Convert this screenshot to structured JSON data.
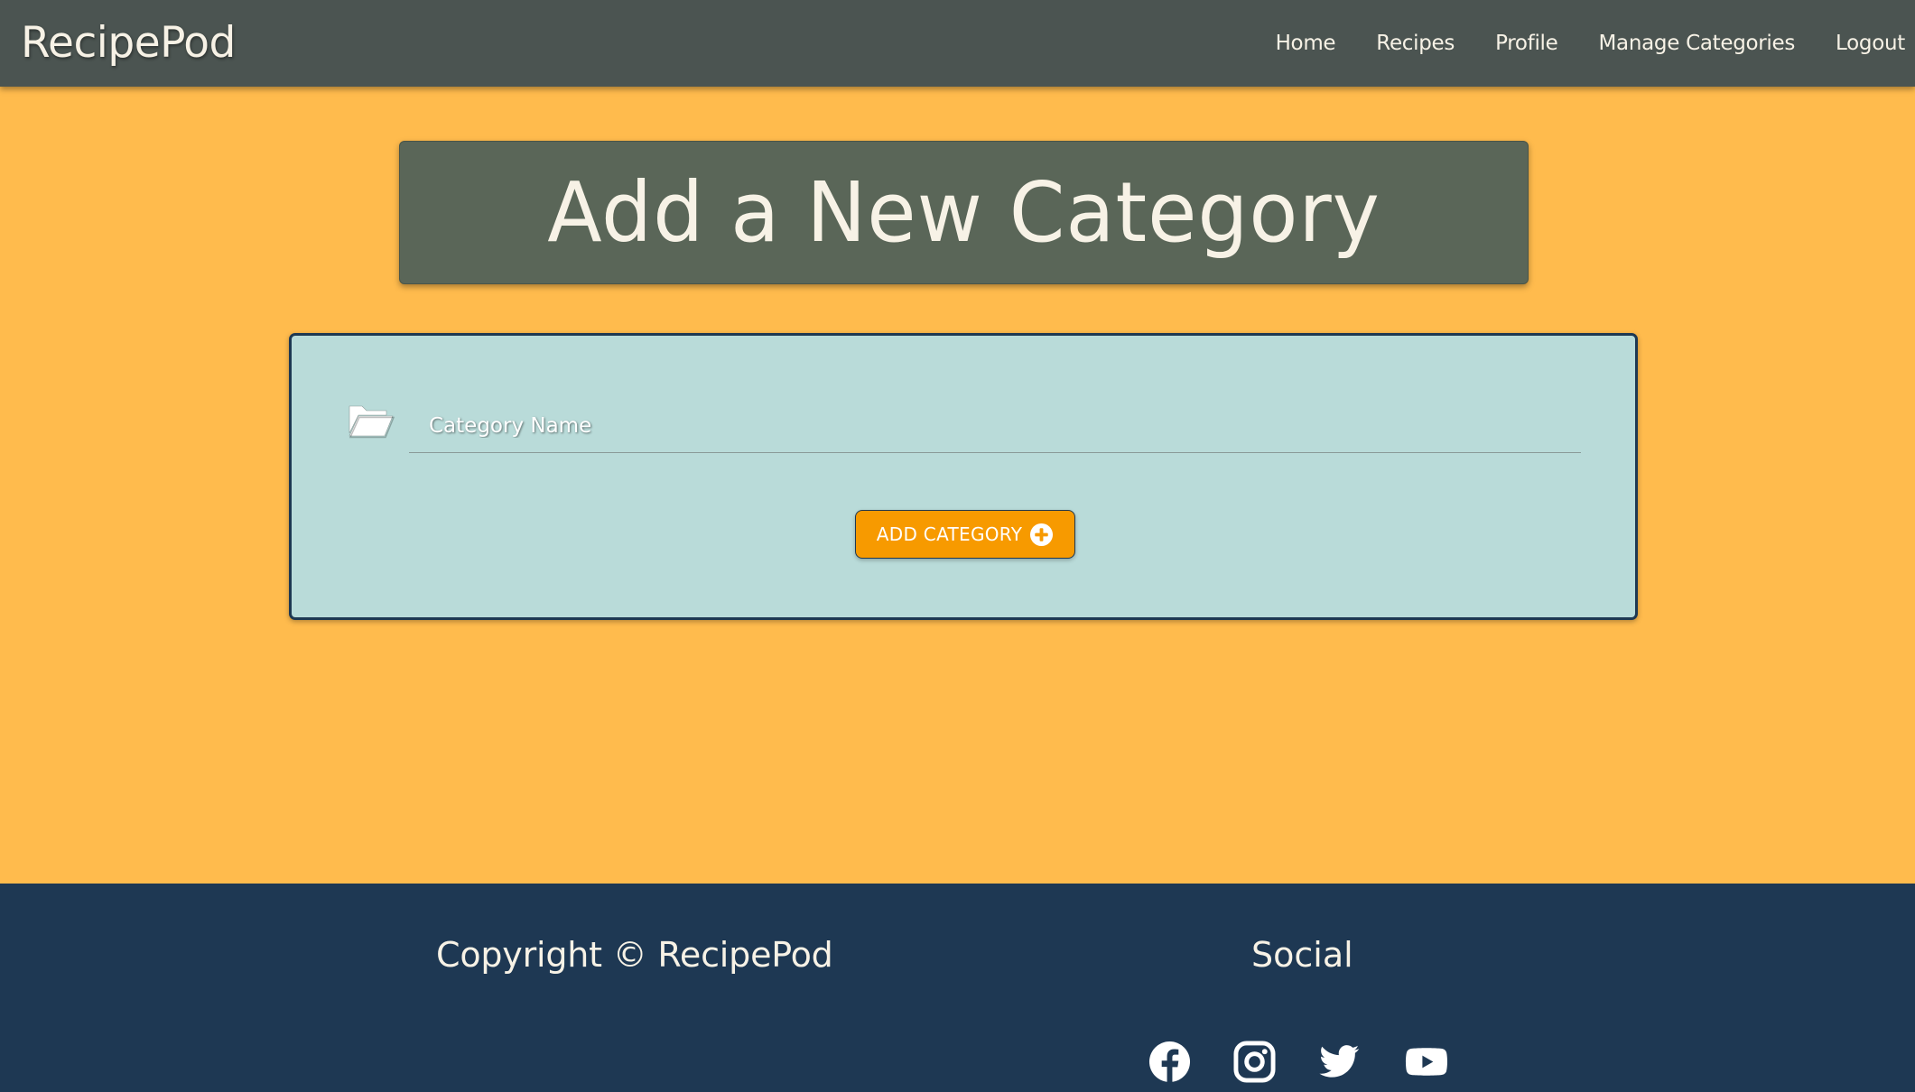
{
  "navbar": {
    "brand": "RecipePod",
    "links": [
      "Home",
      "Recipes",
      "Profile",
      "Manage Categories",
      "Logout"
    ]
  },
  "page": {
    "title": "Add a New Category"
  },
  "form": {
    "field_icon": "folder-open-icon",
    "category_name_placeholder": "Category Name",
    "category_name_value": "",
    "submit_label": "ADD CATEGORY",
    "submit_icon": "plus-circle-icon"
  },
  "footer": {
    "copyright": "Copyright © RecipePod",
    "social_title": "Social",
    "social_icons": [
      "facebook-icon",
      "instagram-icon",
      "twitter-icon",
      "youtube-icon"
    ]
  },
  "colors": {
    "page_bg": "#ffbb4d",
    "navbar_bg": "#4b5451",
    "heading_bg": "#5a6658",
    "card_bg": "#b9dbd9",
    "card_border": "#1e3852",
    "button_bg": "#f79a00",
    "footer_bg": "#1e3853",
    "text_light": "#f7f2e6"
  }
}
